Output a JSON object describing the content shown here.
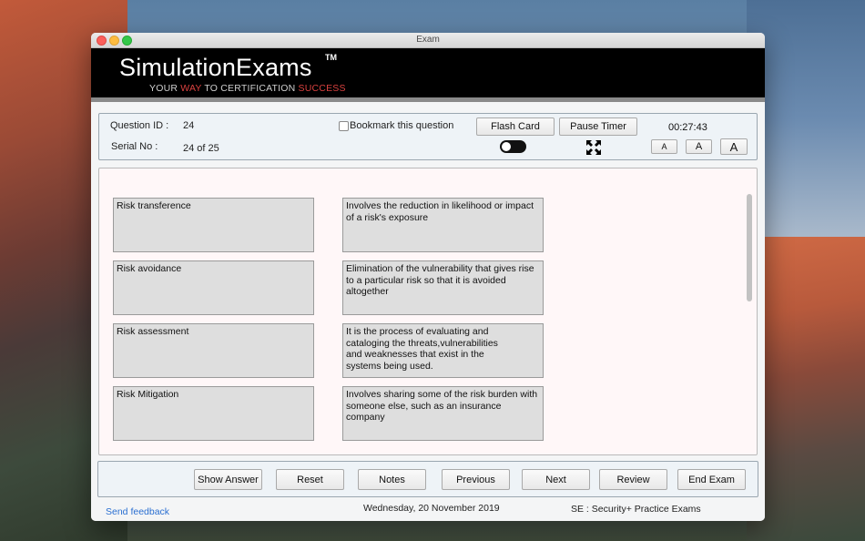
{
  "window": {
    "title": "Exam"
  },
  "banner": {
    "logo": "SimulationExams",
    "trademark": "TM",
    "tagline_parts": [
      "YOUR ",
      "WAY",
      " TO CERTIFICATION ",
      "SUCCESS"
    ]
  },
  "info": {
    "question_id_label": "Question ID :",
    "question_id_value": "24",
    "serial_label": "Serial No :",
    "serial_value": "24 of 25",
    "bookmark_label": "Bookmark this question",
    "bookmark_checked": false,
    "flash_card_label": "Flash Card",
    "pause_timer_label": "Pause Timer",
    "timer": "00:27:43",
    "font_small": "A",
    "font_medium": "A",
    "font_large": "A",
    "toggle_on": false
  },
  "matching": {
    "terms": [
      "Risk transference",
      "Risk avoidance",
      "Risk assessment",
      "Risk Mitigation"
    ],
    "definitions": [
      "Involves the reduction in likelihood or impact\nof a risk's exposure",
      "Elimination of the vulnerability that gives rise\nto a particular risk so that it is avoided\naltogether",
      "It is the process of evaluating and\ncataloging the threats,vulnerabilities\nand weaknesses that exist in the\nsystems being used.",
      "Involves sharing some of the risk burden with\nsomeone else, such as an insurance\ncompany"
    ]
  },
  "buttons": {
    "show_answer": "Show Answer",
    "reset": "Reset",
    "notes": "Notes",
    "previous": "Previous",
    "next": "Next",
    "review": "Review",
    "end_exam": "End Exam"
  },
  "footer": {
    "feedback": "Send feedback",
    "date": "Wednesday, 20 November 2019",
    "product": "SE : Security+ Practice Exams"
  },
  "colors": {
    "accent_red": "#d9413f",
    "link_blue": "#2a6fd1",
    "banner_bg": "#000000"
  }
}
